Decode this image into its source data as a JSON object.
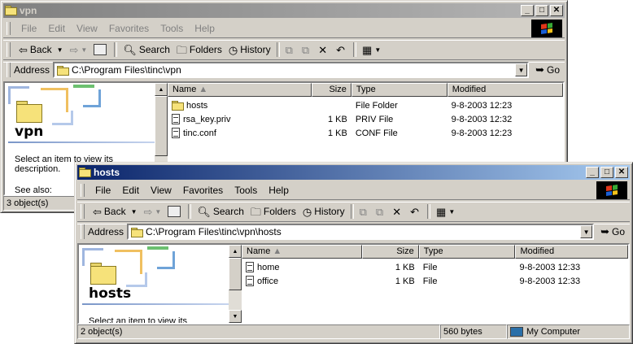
{
  "windows": [
    {
      "id": "vpn",
      "title": "vpn",
      "menu": [
        "File",
        "Edit",
        "View",
        "Favorites",
        "Tools",
        "Help"
      ],
      "toolbar": {
        "back": "Back",
        "search": "Search",
        "folders": "Folders",
        "history": "History"
      },
      "address": {
        "label": "Address",
        "value": "C:\\Program Files\\tinc\\vpn",
        "go": "Go"
      },
      "left_pane": {
        "title": "vpn",
        "description": "Select an item to view its description.",
        "see_also": "See also:"
      },
      "columns": [
        "Name",
        "Size",
        "Type",
        "Modified"
      ],
      "files": [
        {
          "name": "hosts",
          "size": "",
          "type": "File Folder",
          "modified": "9-8-2003 12:23",
          "icon": "folder-icon"
        },
        {
          "name": "rsa_key.priv",
          "size": "1 KB",
          "type": "PRIV File",
          "modified": "9-8-2003 12:32",
          "icon": "file-icon"
        },
        {
          "name": "tinc.conf",
          "size": "1 KB",
          "type": "CONF File",
          "modified": "9-8-2003 12:23",
          "icon": "file-icon"
        }
      ],
      "status": {
        "objects": "3 object(s)"
      }
    },
    {
      "id": "hosts",
      "title": "hosts",
      "menu": [
        "File",
        "Edit",
        "View",
        "Favorites",
        "Tools",
        "Help"
      ],
      "toolbar": {
        "back": "Back",
        "search": "Search",
        "folders": "Folders",
        "history": "History"
      },
      "address": {
        "label": "Address",
        "value": "C:\\Program Files\\tinc\\vpn\\hosts",
        "go": "Go"
      },
      "left_pane": {
        "title": "hosts",
        "description": "Select an item to view its description."
      },
      "columns": [
        "Name",
        "Size",
        "Type",
        "Modified"
      ],
      "files": [
        {
          "name": "home",
          "size": "1 KB",
          "type": "File",
          "modified": "9-8-2003 12:33",
          "icon": "file-icon"
        },
        {
          "name": "office",
          "size": "1 KB",
          "type": "File",
          "modified": "9-8-2003 12:33",
          "icon": "file-icon"
        }
      ],
      "status": {
        "objects": "2 object(s)",
        "size": "560 bytes",
        "zone": "My Computer"
      }
    }
  ]
}
